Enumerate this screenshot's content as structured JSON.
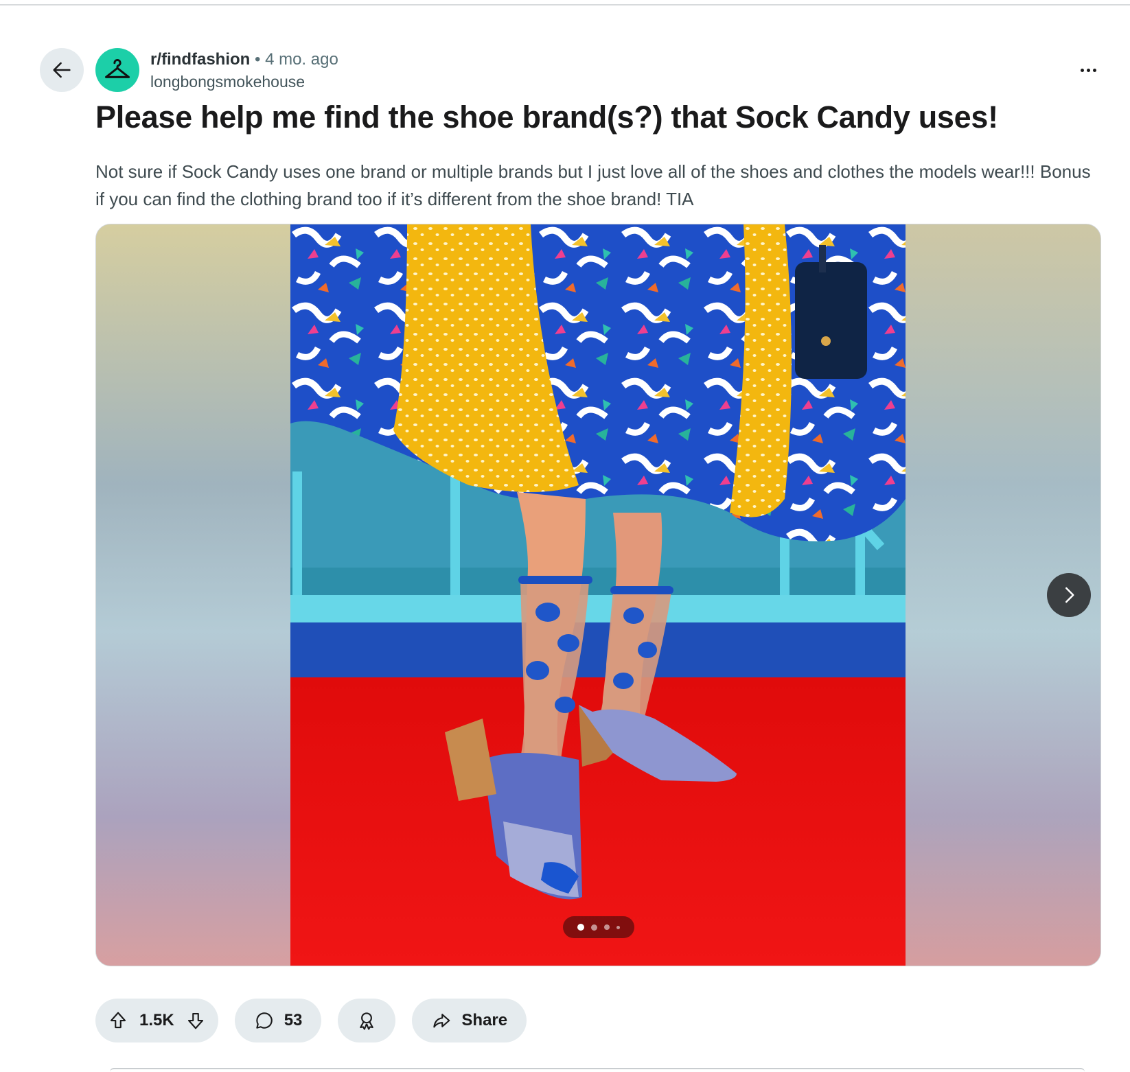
{
  "post": {
    "subreddit": "r/findfashion",
    "separator": "•",
    "age": "4 mo. ago",
    "author": "longbongsmokehouse",
    "title": "Please help me find the shoe brand(s?) that Sock Candy uses!",
    "body": "Not sure if Sock Candy uses one brand or multiple brands but I just love all of the shoes and clothes the models wear!!! Bonus if you can find the clothing brand too if it’s different from the shoe brand! TIA"
  },
  "gallery": {
    "current_index": 1,
    "total_images": 4
  },
  "actions": {
    "vote_count": "1.5K",
    "comment_count": "53",
    "share_label": "Share"
  },
  "icons": {
    "back": "arrow-left-icon",
    "avatar": "hanger-icon",
    "more": "more-horizontal-icon",
    "next": "chevron-right-icon",
    "upvote": "arrow-up-icon",
    "downvote": "arrow-down-icon",
    "comment": "speech-bubble-icon",
    "award": "award-ribbon-icon",
    "share": "share-arrow-icon"
  },
  "colors": {
    "avatar_bg": "#1ccfa8",
    "pill_bg": "#e5ebee",
    "next_button_bg": "#3b3f42"
  }
}
